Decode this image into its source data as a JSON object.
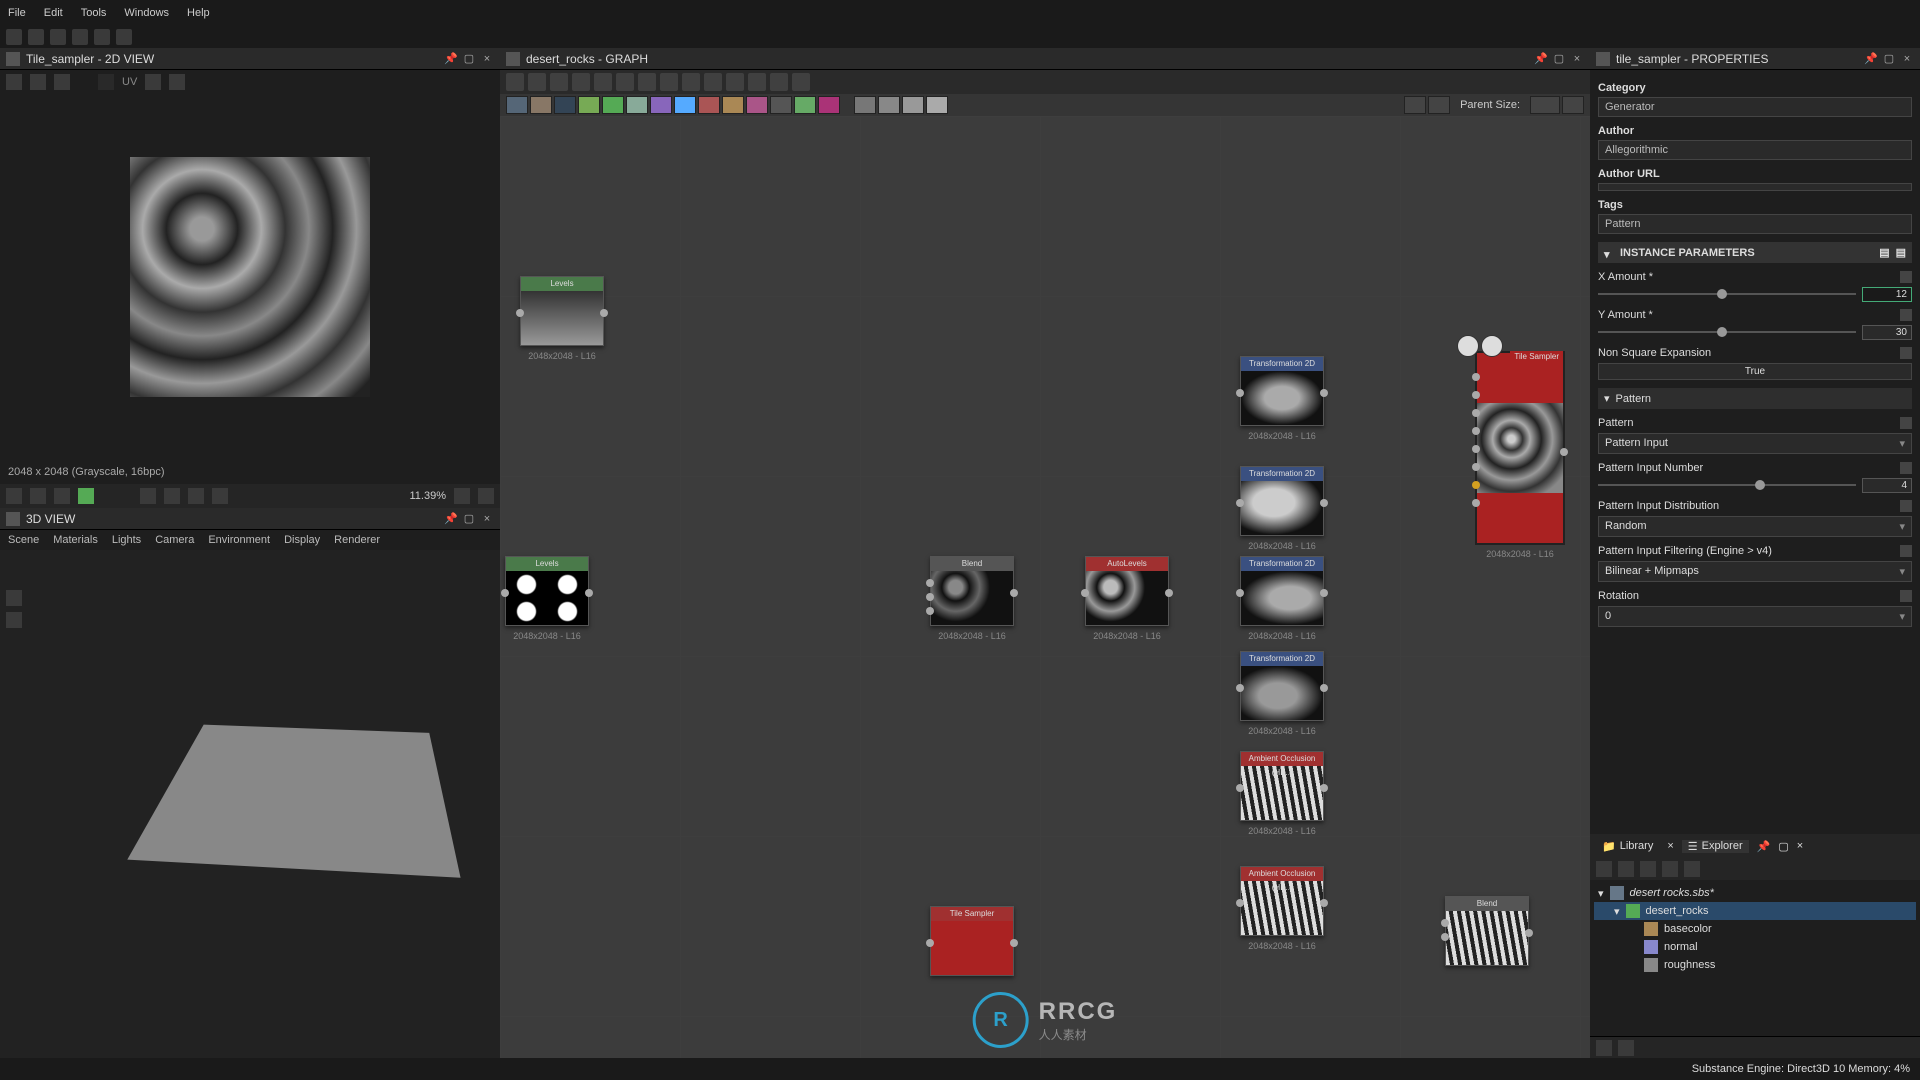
{
  "menu": {
    "file": "File",
    "edit": "Edit",
    "tools": "Tools",
    "windows": "Windows",
    "help": "Help"
  },
  "view2d": {
    "title": "Tile_sampler - 2D VIEW",
    "info": "2048 x 2048 (Grayscale, 16bpc)",
    "zoom": "11.39%"
  },
  "view3d": {
    "title": "3D VIEW",
    "menu": {
      "scene": "Scene",
      "materials": "Materials",
      "lights": "Lights",
      "camera": "Camera",
      "env": "Environment",
      "display": "Display",
      "renderer": "Renderer"
    }
  },
  "graph": {
    "title": "desert_rocks - GRAPH",
    "parent_size": "Parent Size:",
    "resolution": "2048x2048 - L16",
    "nodes": {
      "levels": "Levels",
      "blend": "Blend",
      "autolevels": "AutoLevels",
      "trans2d": "Transformation 2D",
      "ao": "Ambient Occlusion (HB...",
      "tilesampler": "Tile Sampler"
    }
  },
  "properties": {
    "title": "tile_sampler - PROPERTIES",
    "category_lbl": "Category",
    "category_val": "Generator",
    "author_lbl": "Author",
    "author_val": "Allegorithmic",
    "authorurl_lbl": "Author URL",
    "authorurl_val": "",
    "tags_lbl": "Tags",
    "tags_val": "Pattern",
    "instance_params": "INSTANCE PARAMETERS",
    "x_amount": "X Amount *",
    "x_amount_val": "12",
    "y_amount": "Y Amount *",
    "y_amount_val": "30",
    "nonsquare": "Non Square Expansion",
    "nonsquare_val": "True",
    "pattern_section": "Pattern",
    "pattern_lbl": "Pattern",
    "pattern_val": "Pattern Input",
    "pattern_num": "Pattern Input Number",
    "pattern_num_val": "4",
    "pattern_dist": "Pattern Input Distribution",
    "pattern_dist_val": "Random",
    "pattern_filter": "Pattern Input Filtering (Engine > v4)",
    "pattern_filter_val": "Bilinear + Mipmaps",
    "rotation": "Rotation",
    "rotation_val": "0"
  },
  "tabs": {
    "library": "Library",
    "explorer": "Explorer"
  },
  "explorer": {
    "root": "desert rocks.sbs*",
    "graph": "desert_rocks",
    "basecolor": "basecolor",
    "normal": "normal",
    "roughness": "roughness"
  },
  "status": {
    "engine": "Substance Engine: Direct3D 10  Memory: 4%"
  },
  "watermark": {
    "main": "RRCG",
    "sub": "人人素材"
  }
}
